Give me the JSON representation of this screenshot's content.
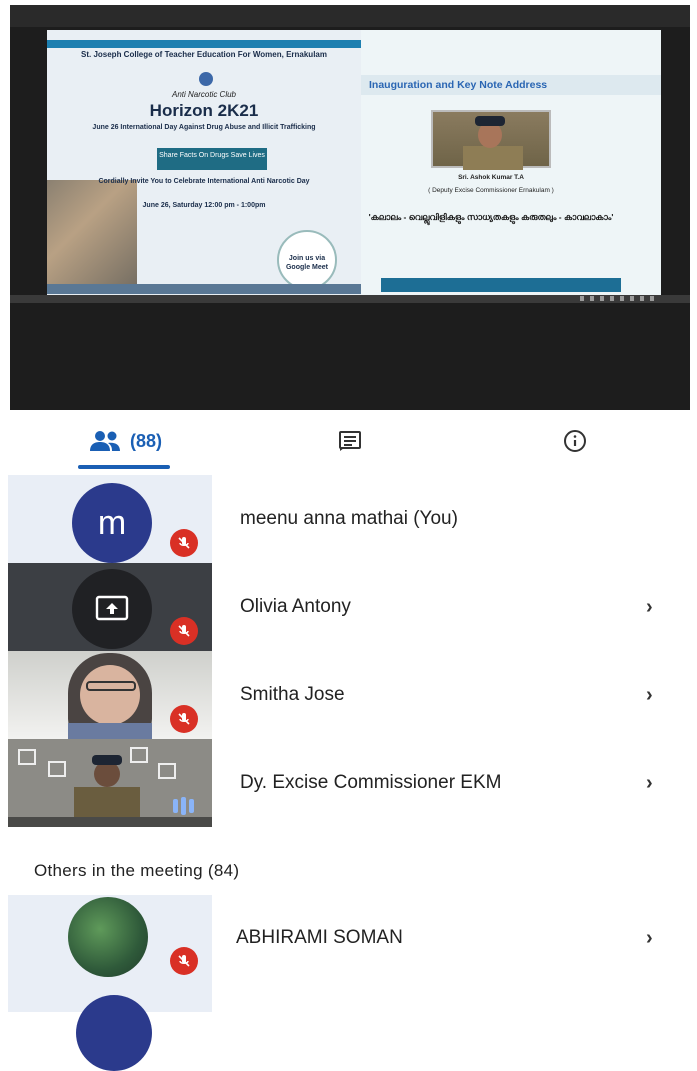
{
  "presentation": {
    "left_slide": {
      "college": "St. Joseph College of Teacher Education For Women, Ernakulam",
      "club": "Anti Narcotic Club",
      "title": "Horizon 2K21",
      "subtitle": "June 26 International Day Against Drug Abuse and Illicit Trafficking",
      "box_text": "Share Facts On Drugs Save Lives",
      "invite": "Cordially Invite You to Celebrate International Anti Narcotic Day",
      "date": "June 26, Saturday 12:00 pm - 1:00pm",
      "meet_label": "Join us via Google Meet"
    },
    "right_slide": {
      "heading": "Inauguration and Key Note Address",
      "speaker": "Sri. Ashok Kumar T.A",
      "role": "( Deputy Excise Commissioner Ernakulam )",
      "quote": "'കലാലം - വെല്ലുവിളികളും സാധ്യതകളും കരുതലും - കാവലാകാം'"
    }
  },
  "tabs": {
    "people_count": "(88)",
    "people_icon": "people-icon",
    "chat_icon": "chat-icon",
    "info_icon": "info-icon",
    "accent": "#1a5fb4"
  },
  "participants": [
    {
      "initial": "m",
      "name": "meenu anna mathai (You)",
      "avatar_color": "#2b3a8c",
      "mic": "muted"
    },
    {
      "name": "Olivia Antony",
      "status_icon": "present-screen-icon",
      "mic": "muted"
    },
    {
      "name": "Smitha Jose",
      "mic": "muted"
    },
    {
      "name": "Dy. Excise Commissioner EKM",
      "mic": "speaking"
    }
  ],
  "others": {
    "title": "Others in the meeting (84)",
    "items": [
      {
        "name": "ABHIRAMI SOMAN",
        "mic": "muted"
      }
    ]
  },
  "colors": {
    "mute_red": "#d93025",
    "tile_bg": "#e9eef6",
    "dark_tile": "#3c3f44"
  }
}
